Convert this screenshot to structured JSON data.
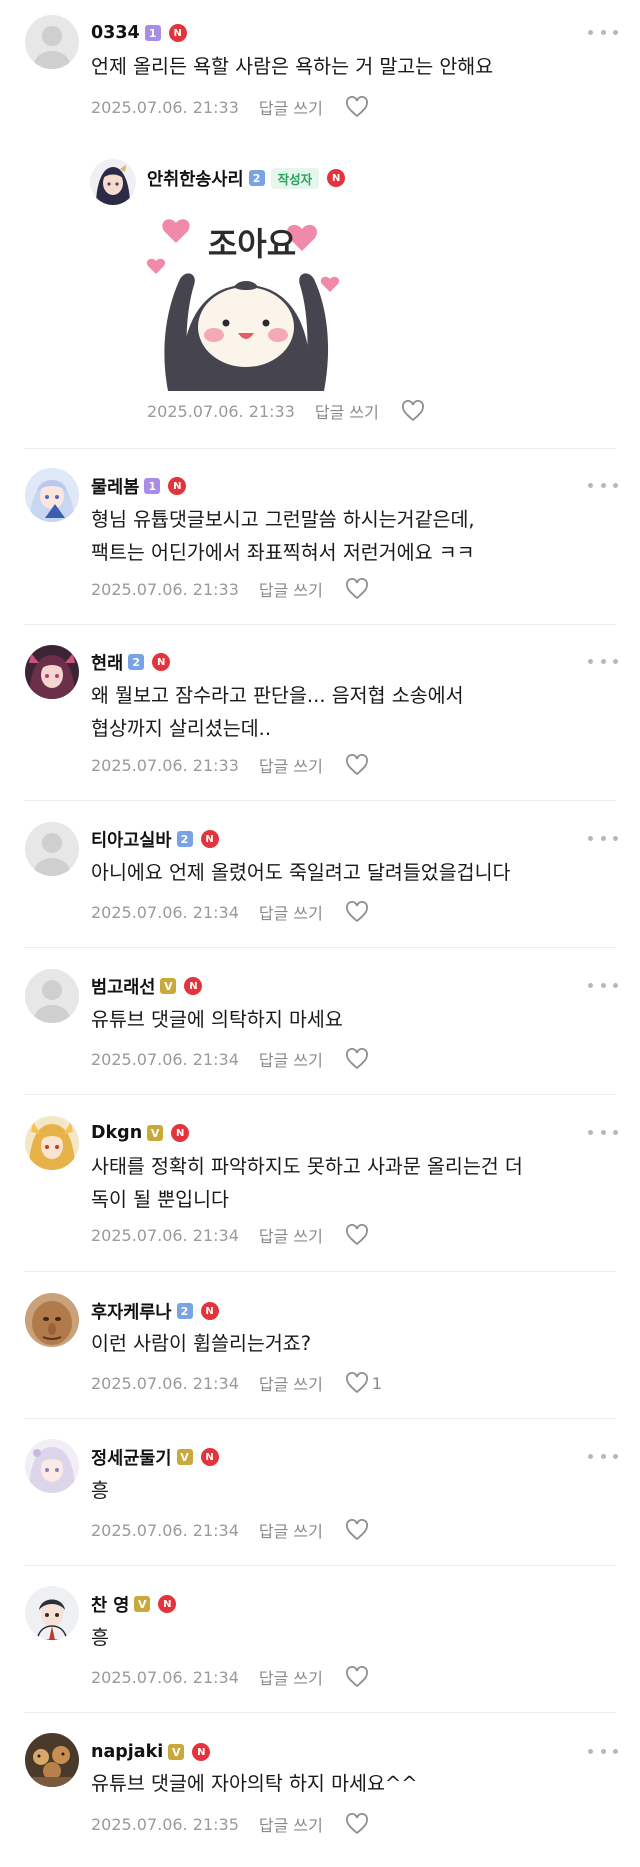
{
  "comments": [
    {
      "nickname": "0334",
      "level": "1",
      "level_color": "purple",
      "text": "언제 올리든 욕할 사람은 욕하는 거 말고는 안해요",
      "date": "2025.07.06. 21:33",
      "reply_label": "답글 쓰기",
      "likes": "",
      "avatar": "default-avatar"
    },
    {
      "nickname": "안취한송사리",
      "level": "2",
      "level_color": "blue",
      "author_tag": "작성자",
      "sticker_text": "조아요",
      "date": "2025.07.06. 21:33",
      "reply_label": "답글 쓰기",
      "likes": "",
      "avatar": "anime-avatar"
    },
    {
      "nickname": "물레봄",
      "level": "1",
      "level_color": "purple",
      "text_lines": [
        "형님 유튭댓글보시고 그런말씀 하시는거같은데,",
        "팩트는 어딘가에서 좌표찍혀서 저런거에요 ㅋㅋ"
      ],
      "date": "2025.07.06. 21:33",
      "reply_label": "답글 쓰기",
      "likes": "",
      "avatar": "anime-avatar"
    },
    {
      "nickname": "현래",
      "level": "2",
      "level_color": "blue",
      "text_lines": [
        "왜 뭘보고 잠수라고 판단을... 음저협 소송에서",
        "협상까지 살리셨는데.."
      ],
      "date": "2025.07.06. 21:33",
      "reply_label": "답글 쓰기",
      "likes": "",
      "avatar": "anime-avatar"
    },
    {
      "nickname": "티아고실바",
      "level": "2",
      "level_color": "blue",
      "text": "아니에요 언제 올렸어도 죽일려고 달려들었을겁니다",
      "date": "2025.07.06. 21:34",
      "reply_label": "답글 쓰기",
      "likes": "",
      "avatar": "default-avatar"
    },
    {
      "nickname": "범고래선",
      "level": "V",
      "level_color": "gold",
      "text": "유튜브 댓글에 의탁하지 마세요",
      "date": "2025.07.06. 21:34",
      "reply_label": "답글 쓰기",
      "likes": "",
      "avatar": "default-avatar"
    },
    {
      "nickname": "Dkgn",
      "level": "V",
      "level_color": "gold",
      "text_lines": [
        "사태를 정확히 파악하지도 못하고 사과문 올리는건 더",
        "독이 될 뿐입니다"
      ],
      "date": "2025.07.06. 21:34",
      "reply_label": "답글 쓰기",
      "likes": "",
      "avatar": "anime-avatar"
    },
    {
      "nickname": "후자케루나",
      "level": "2",
      "level_color": "blue",
      "text": "이런 사람이 휩쓸리는거죠?",
      "date": "2025.07.06. 21:34",
      "reply_label": "답글 쓰기",
      "likes": "1",
      "avatar": "photo-avatar"
    },
    {
      "nickname": "정세균둘기",
      "level": "V",
      "level_color": "gold",
      "text": "흥",
      "date": "2025.07.06. 21:34",
      "reply_label": "답글 쓰기",
      "likes": "",
      "avatar": "anime-avatar"
    },
    {
      "nickname": "찬 영",
      "level": "V",
      "level_color": "gold",
      "text": "흥",
      "date": "2025.07.06. 21:34",
      "reply_label": "답글 쓰기",
      "likes": "",
      "avatar": "anime-avatar"
    },
    {
      "nickname": "napjaki",
      "level": "V",
      "level_color": "gold",
      "text": "유튜브 댓글에 자아의탁 하지 마세요^^",
      "date": "2025.07.06. 21:35",
      "reply_label": "답글 쓰기",
      "likes": "",
      "avatar": "photo-avatar"
    }
  ],
  "icons": {
    "new_badge": "N",
    "more": "more-dots-icon",
    "like": "heart-outline-icon"
  },
  "colors": {
    "new_badge": "#e3343d",
    "author_tag_text": "#25a55a",
    "author_tag_bg": "#e6f6ec",
    "level_purple": "#a98be8",
    "level_blue": "#78a4e6",
    "level_gold": "#c9a93b",
    "meta_text": "#9a9a9a"
  }
}
